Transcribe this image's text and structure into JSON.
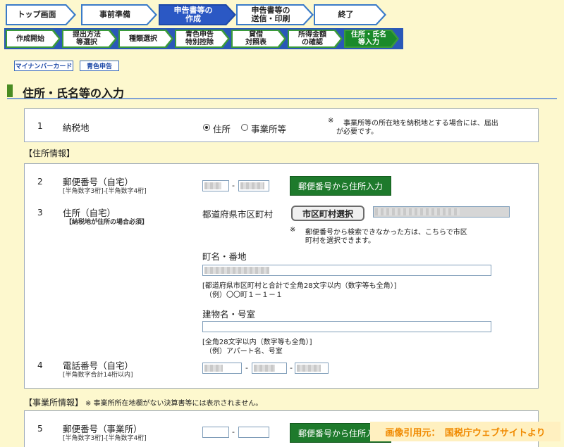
{
  "steps_main": [
    {
      "label": "トップ画面"
    },
    {
      "label": "事前準備"
    },
    {
      "label": "申告書等の\n作成"
    },
    {
      "label": "申告書等の\n送信・印刷"
    },
    {
      "label": "終了"
    }
  ],
  "steps_sub": [
    {
      "label": "作成開始"
    },
    {
      "label": "提出方法\n等選択"
    },
    {
      "label": "種類選択"
    },
    {
      "label": "青色申告\n特別控除"
    },
    {
      "label": "貸借\n対照表"
    },
    {
      "label": "所得金額\nの確認"
    },
    {
      "label": "住所・氏名\n等入力"
    }
  ],
  "tags": {
    "mynumber": "マイナンバーカード",
    "blue": "青色申告"
  },
  "section_title": "住所・氏名等の入力",
  "row1": {
    "num": "1",
    "label": "納税地",
    "opt_home": "住所",
    "opt_office": "事業所等",
    "note_mark": "※",
    "note1": "事業所等の所在地を納税地とする場合には、届出",
    "note2": "が必要です。"
  },
  "home_header": "【住所情報】",
  "row2": {
    "num": "2",
    "label": "郵便番号（自宅）",
    "sub": "[半角数字3桁]-[半角数字4桁]",
    "dash": "-",
    "button": "郵便番号から住所入力"
  },
  "row3": {
    "num": "3",
    "label": "住所（自宅）",
    "sub": "【納税地が住所の場合必須】",
    "city_label": "都道府県市区町村",
    "city_button": "市区町村選択",
    "note_mark": "※",
    "note1": "郵便番号から検索できなかった方は、こちらで市区",
    "note2": "町村を選択できます。",
    "town_label": "町名・番地",
    "town_hint1": "[都道府県市区町村と合計で全角28文字以内（数字等も全角）]",
    "town_hint2": "（例）〇〇町１－１－１",
    "bldg_label": "建物名・号室",
    "bldg_hint1": "[全角28文字以内（数字等も全角）]",
    "bldg_hint2": "（例）アパート名、号室"
  },
  "row4": {
    "num": "4",
    "label": "電話番号（自宅）",
    "sub": "[半角数字合計14桁以内]",
    "dash": "-"
  },
  "office_header": "【事業所情報】",
  "office_note": "※ 事業所所在地欄がない決算書等には表示されません。",
  "row5": {
    "num": "5",
    "label": "郵便番号（事業所）",
    "sub": "[半角数字3桁]-[半角数字4桁]",
    "dash": "-",
    "button": "郵便番号から住所入力"
  },
  "credit": "画像引用元：　国税庁ウェブサイトより"
}
